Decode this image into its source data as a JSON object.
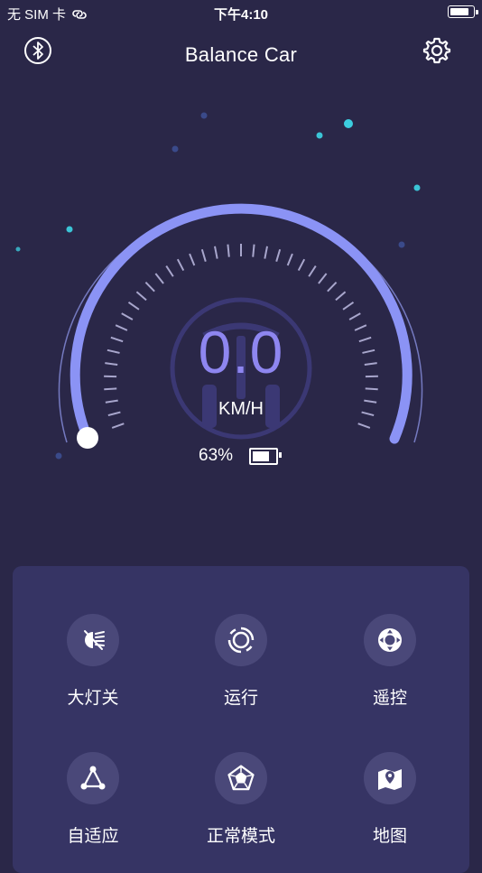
{
  "status_bar": {
    "carrier": "无 SIM 卡",
    "time": "下午4:10"
  },
  "header": {
    "title": "Balance Car"
  },
  "speedometer": {
    "speed": "0.0",
    "unit": "KM/H",
    "battery_text": "63%",
    "battery_level": 0.63
  },
  "controls": [
    {
      "label": "大灯关",
      "icon": "headlight-icon"
    },
    {
      "label": "运行",
      "icon": "run-icon"
    },
    {
      "label": "遥控",
      "icon": "remote-control-icon"
    },
    {
      "label": "自适应",
      "icon": "adaptive-icon"
    },
    {
      "label": "正常模式",
      "icon": "normal-mode-icon"
    },
    {
      "label": "地图",
      "icon": "map-icon"
    }
  ],
  "colors": {
    "background": "#2a2748",
    "panel": "#363464",
    "accent": "#8e86f0",
    "arc": "#8b93f5",
    "star": "#3ee0f0"
  }
}
